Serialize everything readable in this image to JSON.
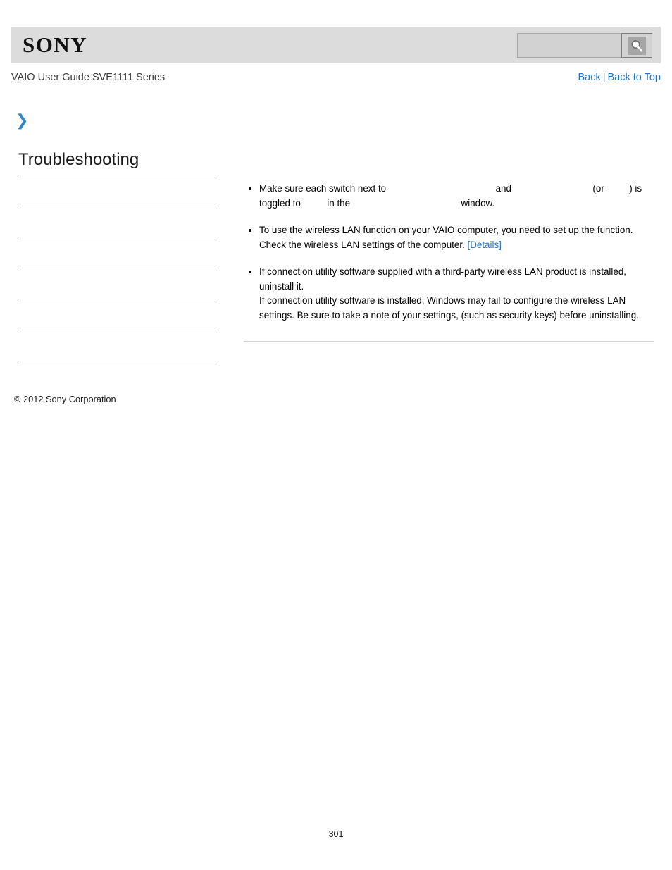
{
  "header": {
    "logo_text": "SONY",
    "search": {
      "value": "",
      "placeholder": "",
      "icon": "search-icon",
      "button_label": ""
    }
  },
  "subheader": {
    "guide_title": "VAIO User Guide SVE1111 Series",
    "nav": {
      "back_label": "Back",
      "separator": "|",
      "back_to_top_label": "Back to Top"
    }
  },
  "breadcrumb": {
    "icon": "chevron-right-icon",
    "glyph": "❯",
    "text": ""
  },
  "sidebar": {
    "title": "Troubleshooting",
    "items": [
      {
        "label": ""
      },
      {
        "label": ""
      },
      {
        "label": ""
      },
      {
        "label": ""
      },
      {
        "label": ""
      },
      {
        "label": ""
      }
    ]
  },
  "content": {
    "bullets": [
      {
        "id": "switch-toggle-bullet",
        "segments": [
          {
            "type": "text",
            "value": "Make sure each switch next to "
          },
          {
            "type": "gap",
            "size": "a"
          },
          {
            "type": "text",
            "value": " and "
          },
          {
            "type": "gap",
            "size": "b"
          },
          {
            "type": "text",
            "value": " (or "
          },
          {
            "type": "gap",
            "size": "c"
          },
          {
            "type": "text",
            "value": ") is toggled to "
          },
          {
            "type": "gap",
            "size": "d"
          },
          {
            "type": "text",
            "value": " in the "
          },
          {
            "type": "gap",
            "size": "e"
          },
          {
            "type": "text",
            "value": " window."
          }
        ],
        "line1_prefix": "Make sure each switch next to",
        "line1_and": "and",
        "line1_or_open": "(or",
        "line1_or_close": ") is",
        "line2_prefix": "toggled to",
        "line2_mid": "in the",
        "line2_suffix": "window."
      },
      {
        "id": "setup-wireless-bullet",
        "line1": "To use the wireless LAN function on your VAIO computer, you need to set up the function.",
        "line2": "Check the wireless LAN settings of the computer.",
        "link_label": "[Details]"
      },
      {
        "id": "third-party-utility-bullet",
        "line1": "If connection utility software supplied with a third-party wireless LAN product is installed, uninstall it.",
        "line2": "If connection utility software is installed, Windows may fail to configure the wireless LAN settings. Be sure to take a note of your settings, (such as security keys) before uninstalling."
      }
    ]
  },
  "footer": {
    "copyright": "© 2012 Sony Corporation",
    "page_number": "301"
  },
  "colors": {
    "header_background": "#dcdcdc",
    "link_blue": "#2176c7",
    "chevron_blue": "#2e86c8",
    "rule_gray": "#d2d2d2",
    "sidebar_rule": "#8b8b8b"
  }
}
